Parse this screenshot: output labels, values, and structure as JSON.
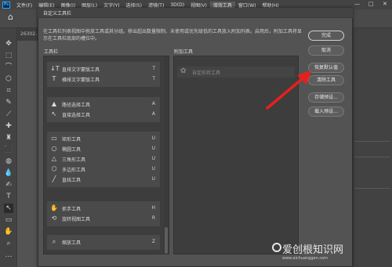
{
  "app": {
    "logo": "Ps",
    "menu": [
      "文件(F)",
      "编辑(E)",
      "图像(I)",
      "图层(L)",
      "文字(Y)",
      "选择(S)",
      "滤镜(T)",
      "3D(D)",
      "视图(V)",
      "增效工具",
      "窗口(W)",
      "帮助(H)"
    ],
    "active_menu_index": 9,
    "window_controls": [
      "—",
      "□",
      "✕"
    ],
    "doc_tab": "26302..."
  },
  "dialog": {
    "title": "自定义工具栏",
    "description": "在工具栏列表视图中拖放工具或其分组。移出超出数量限制、未使用或优先级低的工具放入附加列表。启用后，附加工具将显示在工具栏底部的槽位中。",
    "toolbar_label": "工具栏",
    "extra_label": "附加工具",
    "groups": [
      {
        "rows": [
          {
            "icon": "vertical-type-icon",
            "glyph": "↓T",
            "label": "直排文字蒙版工具",
            "key": "T"
          },
          {
            "icon": "horizontal-type-mask-icon",
            "glyph": "T",
            "label": "横排文字蒙版工具",
            "key": "T"
          }
        ]
      },
      {
        "rows": [
          {
            "icon": "path-select-icon",
            "glyph": "▲",
            "label": "路径选择工具",
            "key": "A"
          },
          {
            "icon": "direct-select-icon",
            "glyph": "↖",
            "label": "直接选择工具",
            "key": "A"
          }
        ]
      },
      {
        "rows": [
          {
            "icon": "rectangle-icon",
            "glyph": "▭",
            "label": "矩形工具",
            "key": "U"
          },
          {
            "icon": "ellipse-icon",
            "glyph": "○",
            "label": "椭圆工具",
            "key": "U"
          },
          {
            "icon": "triangle-icon",
            "glyph": "△",
            "label": "三角形工具",
            "key": "U"
          },
          {
            "icon": "polygon-icon",
            "glyph": "⬡",
            "label": "多边形工具",
            "key": "U"
          },
          {
            "icon": "line-icon",
            "glyph": "╱",
            "label": "直线工具",
            "key": "U"
          }
        ]
      },
      {
        "rows": [
          {
            "icon": "hand-icon",
            "glyph": "✋",
            "label": "抓手工具",
            "key": "H"
          },
          {
            "icon": "rotate-view-icon",
            "glyph": "⟲",
            "label": "旋转视图工具",
            "key": "R"
          }
        ]
      },
      {
        "rows": [
          {
            "icon": "zoom-icon",
            "glyph": "⌕",
            "label": "缩放工具",
            "key": "Z"
          }
        ]
      }
    ],
    "extra_item": {
      "icon": "custom-shape-icon",
      "label": "自定形状工具"
    },
    "buttons": {
      "done": "完成",
      "cancel": "取消",
      "restore_defaults": "恢复默认值",
      "clear_tools": "清除工具",
      "save_preset": "存储预设...",
      "load_preset": "载入预设..."
    },
    "arrow_color": "#e8201c"
  },
  "watermark": {
    "text": "爱创根知识网",
    "sub": "www.aichuanggen.com"
  }
}
